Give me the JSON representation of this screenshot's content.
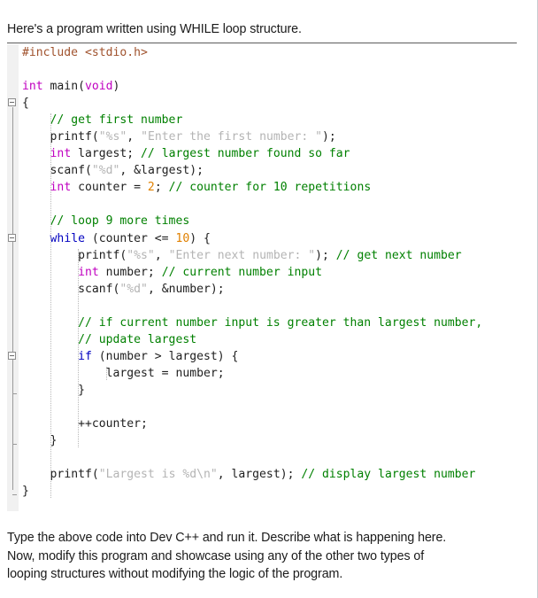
{
  "intro_text": "Here's a program written using WHILE loop structure.",
  "code": {
    "language": "c",
    "lines": [
      {
        "indent": 0,
        "tokens": [
          {
            "t": "pp",
            "s": "#include <stdio.h>"
          }
        ]
      },
      {
        "indent": 0,
        "tokens": []
      },
      {
        "indent": 0,
        "tokens": [
          {
            "t": "t",
            "s": "int"
          },
          {
            "t": "pn",
            "s": " main("
          },
          {
            "t": "t",
            "s": "void"
          },
          {
            "t": "pn",
            "s": ")"
          }
        ]
      },
      {
        "indent": 0,
        "tokens": [
          {
            "t": "pn",
            "s": "{"
          }
        ]
      },
      {
        "indent": 1,
        "tokens": [
          {
            "t": "cm",
            "s": "// get first number"
          }
        ]
      },
      {
        "indent": 1,
        "tokens": [
          {
            "t": "pn",
            "s": "printf("
          },
          {
            "t": "st",
            "s": "\"%s\""
          },
          {
            "t": "pn",
            "s": ", "
          },
          {
            "t": "st",
            "s": "\"Enter the first number: \""
          },
          {
            "t": "pn",
            "s": ");"
          }
        ]
      },
      {
        "indent": 1,
        "tokens": [
          {
            "t": "t",
            "s": "int"
          },
          {
            "t": "pn",
            "s": " largest; "
          },
          {
            "t": "cm",
            "s": "// largest number found so far"
          }
        ]
      },
      {
        "indent": 1,
        "tokens": [
          {
            "t": "pn",
            "s": "scanf("
          },
          {
            "t": "st",
            "s": "\"%d\""
          },
          {
            "t": "pn",
            "s": ", &largest);"
          }
        ]
      },
      {
        "indent": 1,
        "tokens": [
          {
            "t": "t",
            "s": "int"
          },
          {
            "t": "pn",
            "s": " counter = "
          },
          {
            "t": "nu",
            "s": "2"
          },
          {
            "t": "pn",
            "s": "; "
          },
          {
            "t": "cm",
            "s": "// counter for 10 repetitions"
          }
        ]
      },
      {
        "indent": 0,
        "tokens": []
      },
      {
        "indent": 1,
        "tokens": [
          {
            "t": "cm",
            "s": "// loop 9 more times"
          }
        ]
      },
      {
        "indent": 1,
        "tokens": [
          {
            "t": "k",
            "s": "while"
          },
          {
            "t": "pn",
            "s": " (counter <= "
          },
          {
            "t": "nu",
            "s": "10"
          },
          {
            "t": "pn",
            "s": ") {"
          }
        ]
      },
      {
        "indent": 2,
        "tokens": [
          {
            "t": "pn",
            "s": "printf("
          },
          {
            "t": "st",
            "s": "\"%s\""
          },
          {
            "t": "pn",
            "s": ", "
          },
          {
            "t": "st",
            "s": "\"Enter next number: \""
          },
          {
            "t": "pn",
            "s": "); "
          },
          {
            "t": "cm",
            "s": "// get next number"
          }
        ]
      },
      {
        "indent": 2,
        "tokens": [
          {
            "t": "t",
            "s": "int"
          },
          {
            "t": "pn",
            "s": " number; "
          },
          {
            "t": "cm",
            "s": "// current number input"
          }
        ]
      },
      {
        "indent": 2,
        "tokens": [
          {
            "t": "pn",
            "s": "scanf("
          },
          {
            "t": "st",
            "s": "\"%d\""
          },
          {
            "t": "pn",
            "s": ", &number);"
          }
        ]
      },
      {
        "indent": 0,
        "tokens": []
      },
      {
        "indent": 2,
        "tokens": [
          {
            "t": "cm",
            "s": "// if current number input is greater than largest number,"
          }
        ]
      },
      {
        "indent": 2,
        "tokens": [
          {
            "t": "cm",
            "s": "// update largest"
          }
        ]
      },
      {
        "indent": 2,
        "tokens": [
          {
            "t": "k",
            "s": "if"
          },
          {
            "t": "pn",
            "s": " (number > largest) {"
          }
        ]
      },
      {
        "indent": 3,
        "tokens": [
          {
            "t": "pn",
            "s": "largest = number;"
          }
        ]
      },
      {
        "indent": 2,
        "tokens": [
          {
            "t": "pn",
            "s": "}"
          }
        ]
      },
      {
        "indent": 0,
        "tokens": []
      },
      {
        "indent": 2,
        "tokens": [
          {
            "t": "pn",
            "s": "++counter;"
          }
        ]
      },
      {
        "indent": 1,
        "tokens": [
          {
            "t": "pn",
            "s": "}"
          }
        ]
      },
      {
        "indent": 0,
        "tokens": []
      },
      {
        "indent": 1,
        "tokens": [
          {
            "t": "pn",
            "s": "printf("
          },
          {
            "t": "st",
            "s": "\"Largest is %d\\n\""
          },
          {
            "t": "pn",
            "s": ", largest); "
          },
          {
            "t": "cm",
            "s": "// display largest number"
          }
        ]
      },
      {
        "indent": 0,
        "tokens": [
          {
            "t": "pn",
            "s": "}"
          }
        ]
      }
    ],
    "fold_markers": [
      {
        "type": "box",
        "state": "expanded",
        "line": 3
      },
      {
        "type": "box",
        "state": "expanded",
        "line": 11
      },
      {
        "type": "box",
        "state": "expanded",
        "line": 18
      },
      {
        "type": "end",
        "line": 20
      },
      {
        "type": "end",
        "line": 23
      },
      {
        "type": "end",
        "line": 26
      }
    ],
    "colors": {
      "preprocessor": "#a0522d",
      "type_keyword": "#c000c0",
      "control_keyword": "#0000c0",
      "comment": "#008000",
      "string": "#b4b4b4",
      "number": "#e08000",
      "plain": "#202020",
      "gutter_bg": "#f1f1f1",
      "top_border": "#5c5c5c"
    }
  },
  "outro_lines": [
    "Type the above code into Dev C++ and run it. Describe what is happening here.",
    "Now, modify this program and showcase using any of the other two types of",
    "looping structures without modifying the logic of the program."
  ]
}
